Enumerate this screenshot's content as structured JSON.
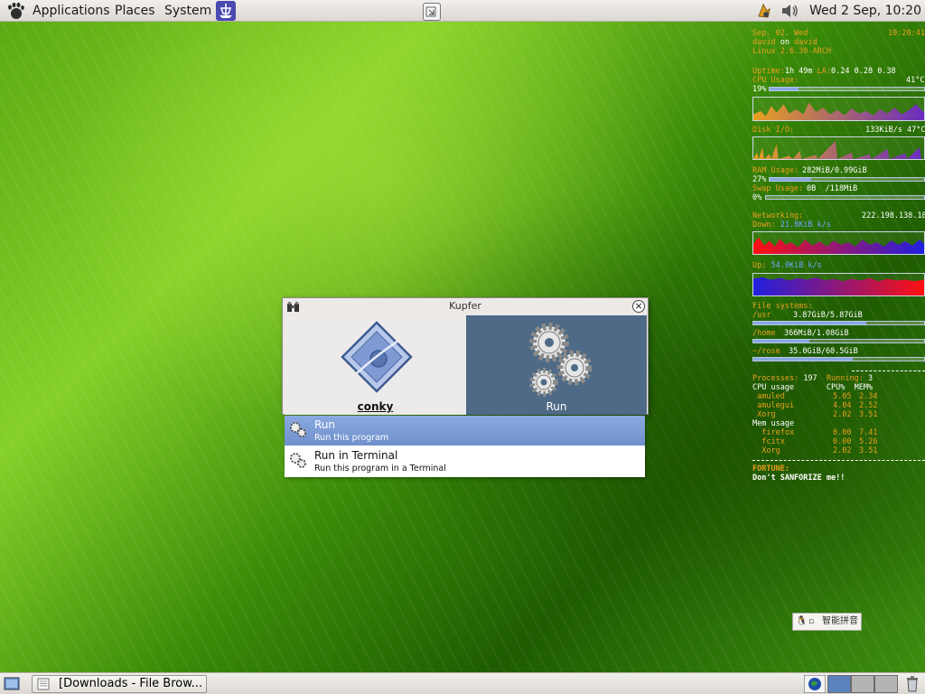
{
  "top_panel": {
    "menus": [
      "Applications",
      "Places",
      "System"
    ],
    "clock": "Wed  2 Sep, 10:20"
  },
  "conky": {
    "date": "Sep. 02. Wed",
    "time": "10:20:41",
    "user": "david",
    "on": "on",
    "host": "david",
    "kernel": "Linux 2.6.30-ARCH",
    "uptime_label": "Uptime:",
    "uptime": "1h 49m",
    "la_label": "LA:",
    "load": "0.24 0.28 0.38",
    "cpu_label": "CPU Usage:",
    "cpu_temp": "41°C",
    "cpu_percent": "19%",
    "cpu_fraction": 0.19,
    "disk_label": "Disk I/O:",
    "disk_stats": "133KiB/s 47°C",
    "ram_label": "RAM Usage:",
    "ram_value": "282MiB/0.99GiB",
    "ram_percent": "27%",
    "ram_fraction": 0.27,
    "swap_label": "Swap Usage:",
    "swap_value": "0B  /118MiB",
    "swap_percent": "0%",
    "swap_fraction": 0.0,
    "network_label": "Networking:",
    "ip": "222.198.138.18",
    "down_label": "Down:",
    "down_rate": "21.8KiB k/s",
    "up_label": "Up:",
    "up_rate": "54.0KiB k/s",
    "fs_label": "File systems:",
    "fs": [
      {
        "mount": "/usr",
        "value": "3.87GiB/5.87GiB",
        "fraction": 0.66
      },
      {
        "mount": "/home",
        "value": "366MiB/1.08GiB",
        "fraction": 0.33
      },
      {
        "mount": "~/rose",
        "value": "35.0GiB/60.5GiB",
        "fraction": 0.58
      }
    ],
    "processes_label": "Processes:",
    "processes": "197",
    "running_label": "Running:",
    "running": "3",
    "cpu_table_header": "CPU usage       CPU%  MEM%",
    "cpu_procs": [
      {
        "name": "amuled",
        "cpu": "5.05",
        "mem": "2.34"
      },
      {
        "name": "amulegui",
        "cpu": "4.04",
        "mem": "2.52"
      },
      {
        "name": "Xorg",
        "cpu": "2.02",
        "mem": "3.51"
      }
    ],
    "mem_table_header": "Mem usage",
    "mem_procs": [
      {
        "name": "firefox",
        "cpu": "0.00",
        "mem": "7.41"
      },
      {
        "name": "fcitx",
        "cpu": "0.00",
        "mem": "5.26"
      },
      {
        "name": "Xorg",
        "cpu": "2.02",
        "mem": "3.51"
      }
    ],
    "fortune_label": "FORTUNE:",
    "fortune": "Don't SANFORIZE me!!"
  },
  "kupfer": {
    "title": "Kupfer",
    "object_label": "conky",
    "action_label": "Run",
    "results": [
      {
        "title": "Run",
        "subtitle": "Run this program"
      },
      {
        "title": "Run in Terminal",
        "subtitle": "Run this program in a Terminal"
      }
    ]
  },
  "ime": {
    "label": "智能拼音"
  },
  "bottom_panel": {
    "task": "[Downloads - File Brow..."
  },
  "colors": {
    "accent_selected": "#7d9dd6",
    "action_pane": "#4e6a86",
    "conky_orange": "#e8a020",
    "conky_blue": "#6fa8ff"
  }
}
